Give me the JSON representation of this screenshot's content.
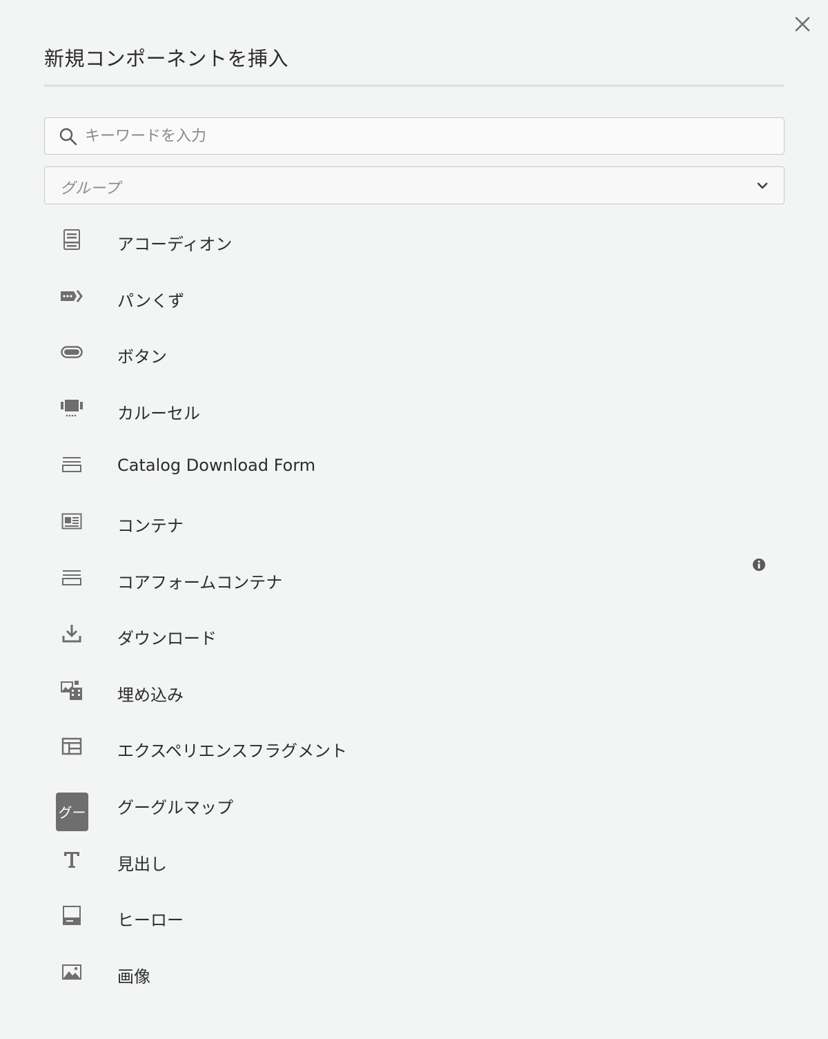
{
  "dialog": {
    "title": "新規コンポーネントを挿入",
    "close_icon": "close-icon"
  },
  "search": {
    "placeholder": "キーワードを入力",
    "value": "",
    "icon": "search-icon"
  },
  "group_filter": {
    "value": "グループ",
    "icon": "chevron-down-icon"
  },
  "components": [
    {
      "label": "アコーディオン",
      "icon": "accordion-icon"
    },
    {
      "label": "パンくず",
      "icon": "breadcrumb-icon"
    },
    {
      "label": "ボタン",
      "icon": "button-icon"
    },
    {
      "label": "カルーセル",
      "icon": "carousel-icon"
    },
    {
      "label": "Catalog Download Form",
      "icon": "form-container-icon"
    },
    {
      "label": "コンテナ",
      "icon": "container-icon"
    },
    {
      "label": "コアフォームコンテナ",
      "icon": "form-container-icon",
      "info_icon": "info-icon"
    },
    {
      "label": "ダウンロード",
      "icon": "download-icon"
    },
    {
      "label": "埋め込み",
      "icon": "embed-icon"
    },
    {
      "label": "エクスペリエンスフラグメント",
      "icon": "experience-fragment-icon"
    },
    {
      "label": "グーグルマップ",
      "icon": "abbreviation-badge",
      "badge": "グー"
    },
    {
      "label": "見出し",
      "icon": "text-icon"
    },
    {
      "label": "ヒーロー",
      "icon": "hero-icon"
    },
    {
      "label": "画像",
      "icon": "image-icon"
    }
  ],
  "colors": {
    "background": "#f3f4f4",
    "text": "#2c2c2c",
    "icon": "#6e6e6e",
    "border": "#c9c9c9",
    "placeholder": "#8a8a8a"
  }
}
